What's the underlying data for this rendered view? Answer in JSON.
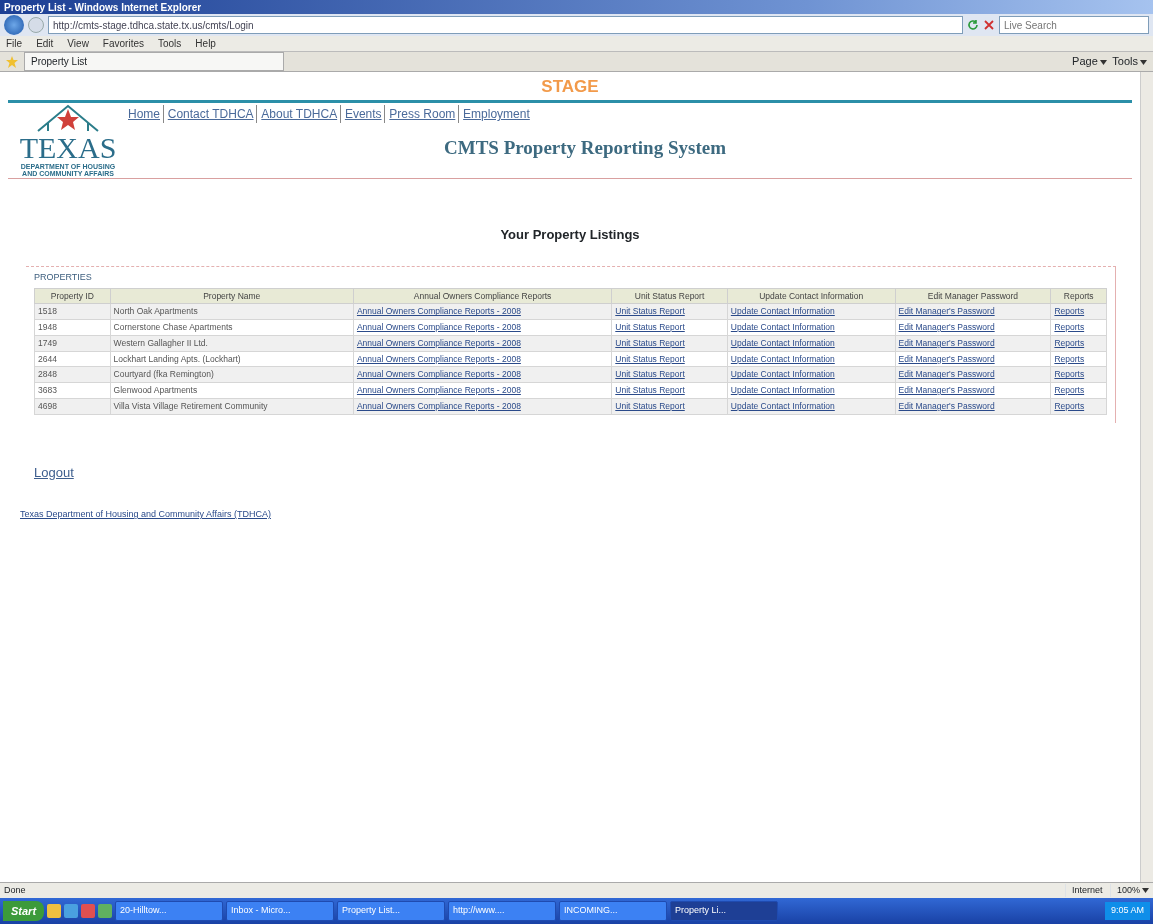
{
  "window": {
    "title": "Property List - Windows Internet Explorer"
  },
  "address_bar": {
    "url": "http://cmts-stage.tdhca.state.tx.us/cmts/Login",
    "search_placeholder": "Live Search"
  },
  "menu": [
    "File",
    "Edit",
    "View",
    "Favorites",
    "Tools",
    "Help"
  ],
  "tabs": [
    {
      "label": "Property List",
      "selected": true
    }
  ],
  "command_bar": [
    "Page",
    "Tools"
  ],
  "page": {
    "banner": "STAGE",
    "logo": {
      "word": "TEXAS",
      "line_1": "DEPARTMENT OF HOUSING",
      "line_2": "AND COMMUNITY AFFAIRS"
    },
    "nav": [
      "Home",
      "Contact TDHCA",
      "About TDHCA",
      "Events",
      "Press Room",
      "Employment"
    ],
    "site_title": "CMTS Property Reporting System",
    "heading": "Your Property Listings",
    "section_label": "PROPERTIES",
    "table": {
      "columns": [
        "Property ID",
        "Property Name",
        "Annual Owners Compliance Reports",
        "Unit Status Report",
        "Update Contact Information",
        "Edit Manager Password",
        "Reports"
      ],
      "rows": [
        [
          "1518",
          "North Oak Apartments",
          "Annual Owners Compliance Reports - 2008",
          "Unit Status Report",
          "Update Contact Information",
          "Edit Manager's Password",
          "Reports"
        ],
        [
          "1948",
          "Cornerstone Chase Apartments",
          "Annual Owners Compliance Reports - 2008",
          "Unit Status Report",
          "Update Contact Information",
          "Edit Manager's Password",
          "Reports"
        ],
        [
          "1749",
          "Western Gallagher II Ltd.",
          "Annual Owners Compliance Reports - 2008",
          "Unit Status Report",
          "Update Contact Information",
          "Edit Manager's Password",
          "Reports"
        ],
        [
          "2644",
          "Lockhart Landing Apts. (Lockhart)",
          "Annual Owners Compliance Reports - 2008",
          "Unit Status Report",
          "Update Contact Information",
          "Edit Manager's Password",
          "Reports"
        ],
        [
          "2848",
          "Courtyard (fka Remington)",
          "Annual Owners Compliance Reports - 2008",
          "Unit Status Report",
          "Update Contact Information",
          "Edit Manager's Password",
          "Reports"
        ],
        [
          "3683",
          "Glenwood Apartments",
          "Annual Owners Compliance Reports - 2008",
          "Unit Status Report",
          "Update Contact Information",
          "Edit Manager's Password",
          "Reports"
        ],
        [
          "4698",
          "Villa Vista Village Retirement Community",
          "Annual Owners Compliance Reports - 2008",
          "Unit Status Report",
          "Update Contact Information",
          "Edit Manager's Password",
          "Reports"
        ]
      ]
    },
    "logout": "Logout",
    "footer_link": "Texas Department of Housing and Community Affairs (TDHCA)"
  },
  "status_bar": {
    "text": "Done",
    "zone": "Internet",
    "zoom": "100%"
  },
  "taskbar": {
    "start": "Start",
    "buttons": [
      {
        "label": "20-Hilltow...",
        "selected": false
      },
      {
        "label": "Inbox - Micro...",
        "selected": false
      },
      {
        "label": "Property List...",
        "selected": false
      },
      {
        "label": "http://www....",
        "selected": false
      },
      {
        "label": "INCOMING...",
        "selected": false
      },
      {
        "label": "Property Li...",
        "selected": true
      }
    ],
    "clock": "9:05 AM"
  }
}
